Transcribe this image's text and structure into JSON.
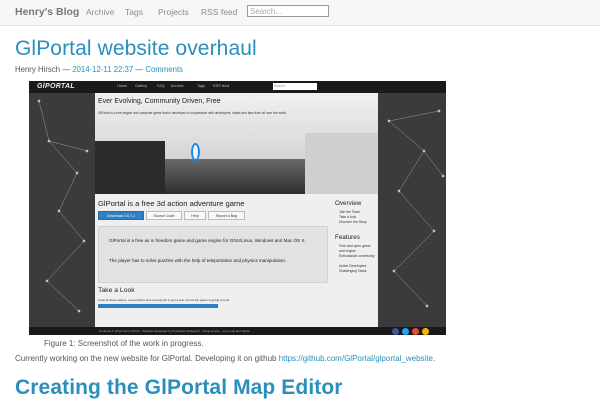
{
  "navbar": {
    "brand": "Henry's Blog",
    "links": [
      "Archive",
      "Tags",
      "Projects",
      "RSS feed"
    ],
    "search_placeholder": "Search..."
  },
  "post": {
    "title": "GlPortal website overhaul",
    "author": "Henry Hirsch",
    "separator": "—",
    "date": "2014-12-11 22:37",
    "comments_label": "Comments",
    "figure_caption": "Figure 1: Screenshot of the work in progress.",
    "body_text": "Currently working on the new website for GlPortal. Developing it on github ",
    "body_link": "https://github.com/GlPortal/glportal_website",
    "body_end": "."
  },
  "next_post": {
    "title": "Creating the GlPortal Map Editor"
  },
  "screenshot": {
    "logo": "GlPORTAL",
    "nav": [
      "Home",
      "Gallery",
      "FAQ",
      "Archive",
      "Tags",
      "RSS feed"
    ],
    "search_placeholder": "Search",
    "hero_title": "Ever Evolving, Community Driven, Free",
    "hero_sub": "GlPortal is a free engine and computer game that is developed in cooperation with developers, artists and fans from all over the world.",
    "main_title": "GlPortal is a free 3d action adventure game",
    "buttons": [
      "Download 0.6.7.1",
      "Source Code",
      "Help",
      "Report a Bug"
    ],
    "desc_1": "GlPortal is a free as in freedom game and game engine for GNU/Linux, Windows and Mac OS X.",
    "desc_2": "The player has to solve puzzles with the help of teleportation and physics manipulation.",
    "look_title": "Take a Look",
    "look_sub": "Look at these videos, screenshots and concept art to get a feel of how the game is going to look.",
    "overview_title": "Overview",
    "overview_items": [
      "Join the Team",
      "Take a look",
      "Discover the Story"
    ],
    "features_title": "Features",
    "features_items": [
      "Free and open game and engine",
      "Enthusiastic community",
      "Active Developers",
      "Challenging Tasks"
    ],
    "footer": "Contents © 2014 Henry Hirsch · Website Generator by Pycrawler (Dragonfl) · Using emacs · org mode and nikola",
    "social_colors": [
      "#3b5998",
      "#1da1f2",
      "#dd4b39",
      "#f4b400"
    ]
  }
}
